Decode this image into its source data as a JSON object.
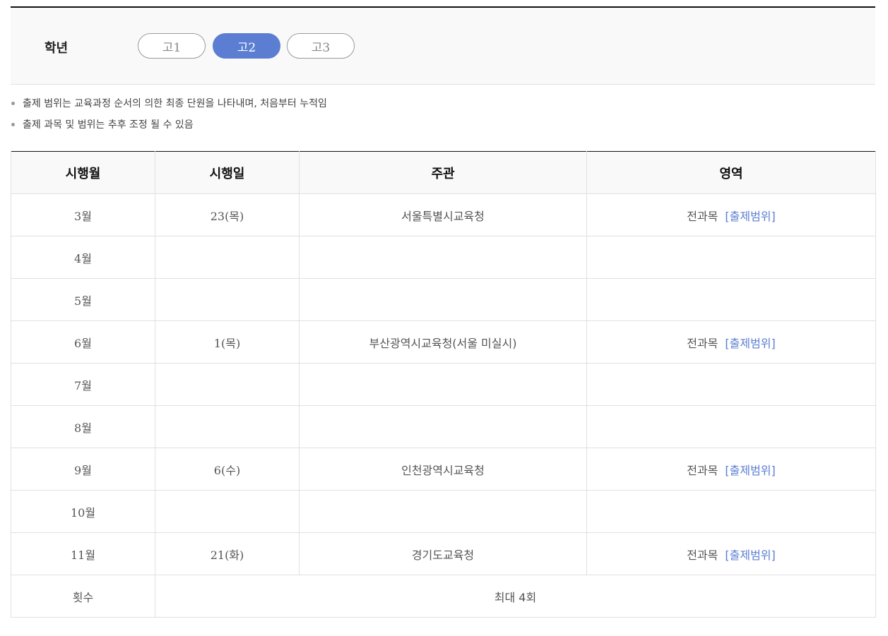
{
  "grade": {
    "label": "학년",
    "options": [
      "고1",
      "고2",
      "고3"
    ],
    "selected": "고2"
  },
  "notes": [
    "출제 범위는 교육과정 순서의 의한 최종 단원을 나타내며, 처음부터 누적임",
    "출제 과목 및 범위는 추후 조정 될 수 있음"
  ],
  "table": {
    "headers": [
      "시행월",
      "시행일",
      "주관",
      "영역"
    ],
    "rows": [
      {
        "month": "3월",
        "day": "23(목)",
        "org": "서울특별시교육청",
        "area": "전과목",
        "link": "[출제범위]"
      },
      {
        "month": "4월",
        "day": "",
        "org": "",
        "area": "",
        "link": ""
      },
      {
        "month": "5월",
        "day": "",
        "org": "",
        "area": "",
        "link": ""
      },
      {
        "month": "6월",
        "day": "1(목)",
        "org": "부산광역시교육청(서울 미실시)",
        "area": "전과목",
        "link": "[출제범위]"
      },
      {
        "month": "7월",
        "day": "",
        "org": "",
        "area": "",
        "link": ""
      },
      {
        "month": "8월",
        "day": "",
        "org": "",
        "area": "",
        "link": ""
      },
      {
        "month": "9월",
        "day": "6(수)",
        "org": "인천광역시교육청",
        "area": "전과목",
        "link": "[출제범위]"
      },
      {
        "month": "10월",
        "day": "",
        "org": "",
        "area": "",
        "link": ""
      },
      {
        "month": "11월",
        "day": "21(화)",
        "org": "경기도교육청",
        "area": "전과목",
        "link": "[출제범위]"
      }
    ],
    "footer": {
      "label": "횟수",
      "value": "최대 4회"
    }
  },
  "colors": {
    "accent": "#5b7ed2",
    "header_bg": "#f9f9f9",
    "border": "#e0e0e0"
  }
}
